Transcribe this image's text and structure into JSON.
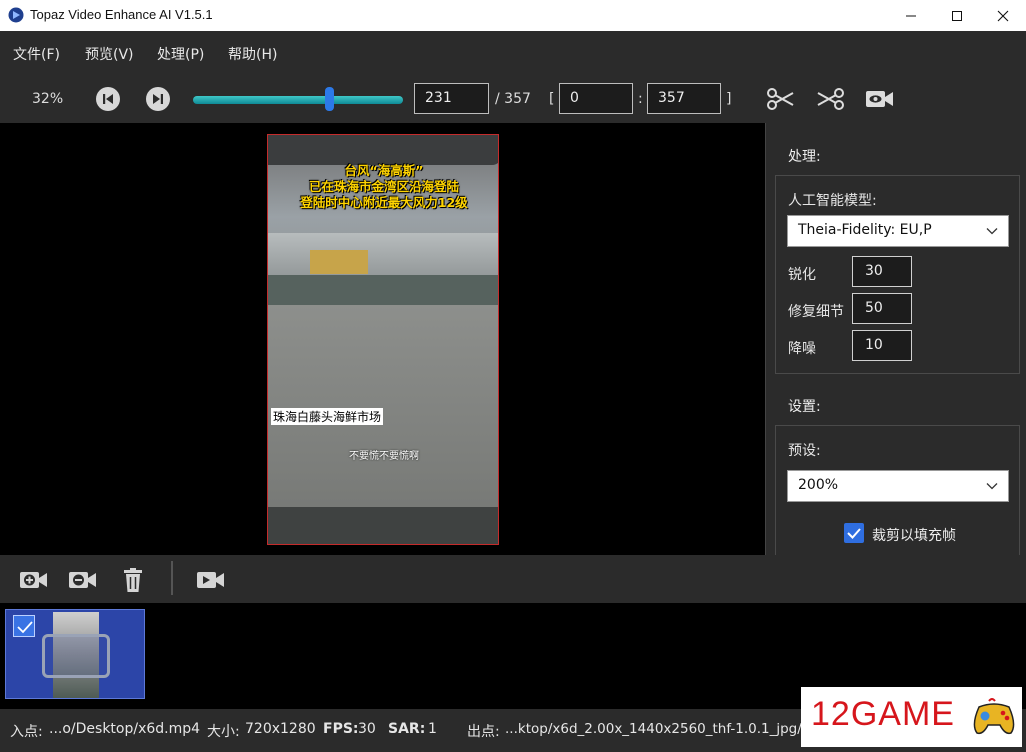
{
  "window": {
    "title": "Topaz Video Enhance AI V1.5.1"
  },
  "menu": [
    "文件(F)",
    "预览(V)",
    "处理(P)",
    "帮助(H)"
  ],
  "toolbar": {
    "zoom": "32%",
    "current_frame": "231",
    "total_frames": "/ 357",
    "range_open": "[",
    "range_start": "0",
    "range_colon": ":",
    "range_end": "357",
    "range_close": "]",
    "slider_fraction": 0.647
  },
  "video": {
    "headline_lines": [
      "台风“海高斯”",
      "已在珠海市金湾区沿海登陆",
      "登陆时中心附近最大风力12级"
    ],
    "place_label": "珠海白藤头海鲜市场",
    "sub_caption": "不要慌不要慌啊"
  },
  "panel": {
    "processing_title": "处理:",
    "ai_model_label": "人工智能模型:",
    "ai_model_value": "Theia-Fidelity: EU,P",
    "sharpen_label": "锐化",
    "sharpen_value": "30",
    "detail_label": "修复细节",
    "detail_value": "50",
    "denoise_label": "降噪",
    "denoise_value": "10",
    "settings_title": "设置:",
    "preset_label": "预设:",
    "preset_value": "200%",
    "crop_label": "裁剪以填充帧",
    "crop_checked": true
  },
  "status": {
    "in_label": "入点:",
    "in_value": "...o/Desktop/x6d.mp4",
    "size_label": "大小:",
    "size_value": "720x1280",
    "fps_label": "FPS:",
    "fps_value": "30",
    "sar_label": "SAR:",
    "sar_value": "1",
    "out_label": "出点:",
    "out_value": "...ktop/x6d_2.00x_1440x2560_thf-1.0.1_jpg/"
  },
  "watermark": {
    "text": "12GAME"
  },
  "colors": {
    "accent": "#2f6ee0",
    "slider_teal": "#2bb3b8",
    "preview_border": "#c42b2b"
  }
}
